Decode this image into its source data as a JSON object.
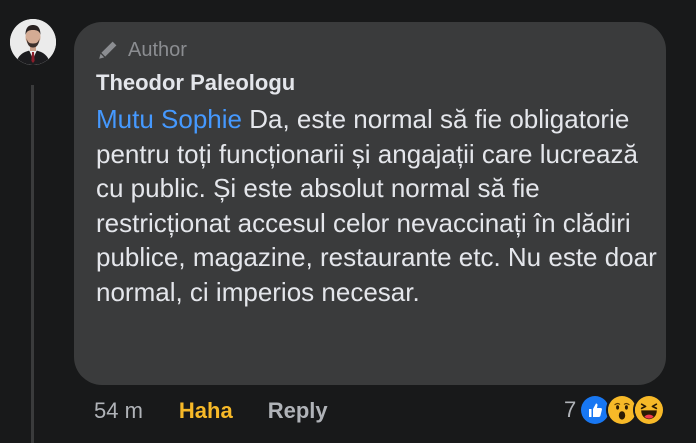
{
  "comment": {
    "author_badge": "Author",
    "author_name": "Theodor Paleologu",
    "mention": "Mutu Sophie",
    "text": " Da, este normal să fie obligatorie pentru toți funcționarii și angajații care lucrează cu public. Și este absolut normal să fie restricționat accesul celor nevaccinați în clădiri publice, magazine, restaurante etc. Nu este doar normal, ci imperios necesar.",
    "timestamp": "54 m",
    "reacted_label": "Haha",
    "reply_label": "Reply",
    "reaction_count": "7",
    "reaction_icons": [
      "like-icon",
      "wow-icon",
      "haha-icon"
    ]
  },
  "colors": {
    "background": "#18191a",
    "bubble": "#3a3b3c",
    "text": "#e4e6eb",
    "mention": "#4599ff",
    "haha": "#f7b928",
    "muted": "#b0b3b8"
  }
}
